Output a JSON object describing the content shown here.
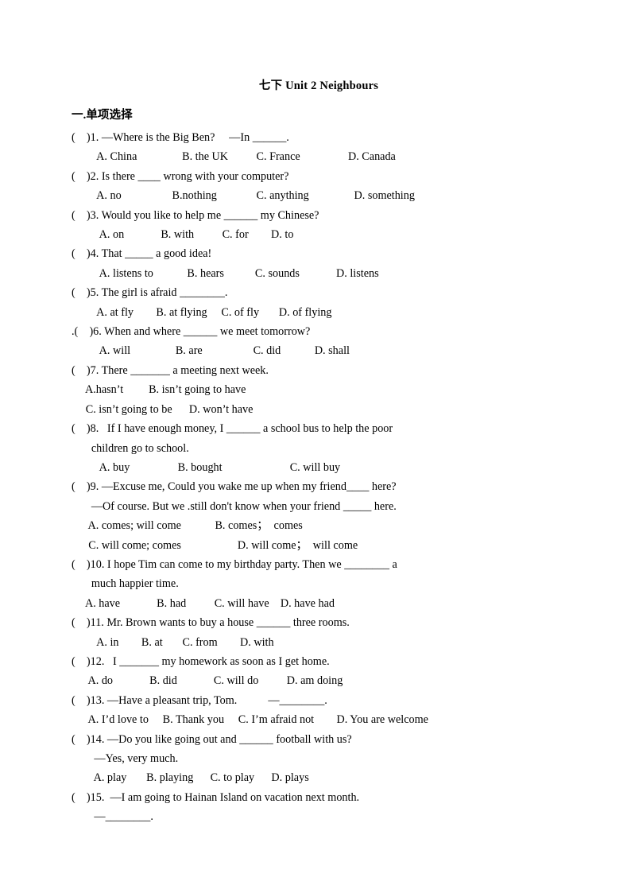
{
  "document": {
    "title": "七下 Unit 2 Neighbours",
    "section_heading": "一.单项选择"
  },
  "questions": [
    {
      "marker": "(    )1. ",
      "stem": "—Where is the Big Ben?     —In ______.",
      "continuation": null,
      "option_lines": [
        "         A. China                B. the UK          C. France                 D. Canada"
      ]
    },
    {
      "marker": "(    )2. ",
      "stem": "Is there ____ wrong with your computer?",
      "continuation": null,
      "option_lines": [
        "         A. no                  B.nothing              C. anything                D. something"
      ]
    },
    {
      "marker": "(    )3. ",
      "stem": "Would you like to help me ______ my Chinese?",
      "continuation": null,
      "option_lines": [
        "          A. on             B. with          C. for        D. to"
      ]
    },
    {
      "marker": "(    )4. ",
      "stem": "That _____ a good idea!",
      "continuation": null,
      "option_lines": [
        "          A. listens to            B. hears           C. sounds             D. listens"
      ]
    },
    {
      "marker": "(    )5. ",
      "stem": "The girl is afraid ________.",
      "continuation": null,
      "option_lines": [
        "         A. at fly        B. at flying     C. of fly       D. of flying"
      ]
    },
    {
      "marker": ".(    )6. ",
      "stem": "When and where ______ we meet tomorrow?",
      "continuation": null,
      "option_lines": [
        "          A. will                B. are                  C. did            D. shall"
      ]
    },
    {
      "marker": "(    )7. ",
      "stem": "There _______ a meeting next week.",
      "continuation": null,
      "option_lines": [
        "     A.hasn’t         B. isn’t going to have",
        "     C. isn’t going to be      D. won’t have"
      ]
    },
    {
      "marker": "(    )8.  ",
      "stem": " If I have enough money, I ______ a school bus to help the poor",
      "continuation": "       children go to school.",
      "option_lines": [
        "          A. buy                 B. bought                        C. will buy"
      ]
    },
    {
      "marker": "(    )9. ",
      "stem": "—Excuse me, Could you wake me up when my friend____ here?",
      "continuation": "       —Of course. But we .still don't know when your friend _____ here.",
      "option_lines": [
        "      A. comes; will come            B. comes；  comes",
        "      C. will come; comes                    D. will come；  will come"
      ]
    },
    {
      "marker": "(    )10. ",
      "stem": "I hope Tim can come to my birthday party. Then we ________ a",
      "continuation": "       much happier time.",
      "option_lines": [
        "     A. have             B. had          C. will have    D. have had"
      ]
    },
    {
      "marker": "(    )11. ",
      "stem": "Mr. Brown wants to buy a house ______ three rooms.",
      "continuation": null,
      "option_lines": [
        "         A. in        B. at       C. from        D. with"
      ]
    },
    {
      "marker": "(    )12.  ",
      "stem": " I _______ my homework as soon as I get home.",
      "continuation": null,
      "option_lines": [
        "      A. do             B. did             C. will do          D. am doing"
      ]
    },
    {
      "marker": "(    )13. ",
      "stem": "—Have a pleasant trip, Tom.           —________.",
      "continuation": null,
      "option_lines": [
        "      A. I’d love to     B. Thank you     C. I’m afraid not        D. You are welcome"
      ]
    },
    {
      "marker": "(    )14. ",
      "stem": "—Do you like going out and ______ football with us?",
      "continuation": "        —Yes, very much.",
      "option_lines": [
        "        A. play       B. playing      C. to play      D. plays"
      ]
    },
    {
      "marker": "(    )15.  ",
      "stem": "—I am going to Hainan Island on vacation next month.",
      "continuation": "        —________.",
      "option_lines": []
    }
  ]
}
